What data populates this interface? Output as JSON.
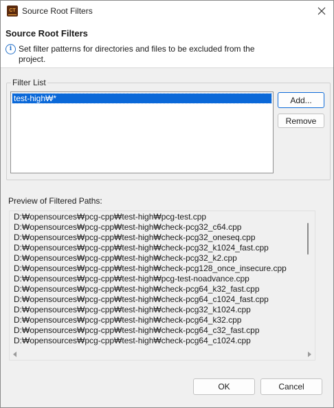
{
  "window": {
    "app_icon_text": "CT",
    "title": "Source Root Filters"
  },
  "header": {
    "title": "Source Root Filters",
    "message": "Set filter patterns for directories and files to be excluded from the project."
  },
  "filter_list": {
    "group_label": "Filter List",
    "items": [
      "test-high₩*"
    ],
    "selected_index": 0
  },
  "buttons": {
    "add": "Add...",
    "remove": "Remove",
    "ok": "OK",
    "cancel": "Cancel"
  },
  "preview": {
    "label": "Preview of Filtered Paths:",
    "paths": [
      "D:₩opensources₩pcg-cpp₩test-high₩pcg-test.cpp",
      "D:₩opensources₩pcg-cpp₩test-high₩check-pcg32_c64.cpp",
      "D:₩opensources₩pcg-cpp₩test-high₩check-pcg32_oneseq.cpp",
      "D:₩opensources₩pcg-cpp₩test-high₩check-pcg32_k1024_fast.cpp",
      "D:₩opensources₩pcg-cpp₩test-high₩check-pcg32_k2.cpp",
      "D:₩opensources₩pcg-cpp₩test-high₩check-pcg128_once_insecure.cpp",
      "D:₩opensources₩pcg-cpp₩test-high₩pcg-test-noadvance.cpp",
      "D:₩opensources₩pcg-cpp₩test-high₩check-pcg64_k32_fast.cpp",
      "D:₩opensources₩pcg-cpp₩test-high₩check-pcg64_c1024_fast.cpp",
      "D:₩opensources₩pcg-cpp₩test-high₩check-pcg32_k1024.cpp",
      "D:₩opensources₩pcg-cpp₩test-high₩check-pcg64_k32.cpp",
      "D:₩opensources₩pcg-cpp₩test-high₩check-pcg64_c32_fast.cpp",
      "D:₩opensources₩pcg-cpp₩test-high₩check-pcg64_c1024.cpp"
    ]
  },
  "colors": {
    "selection": "#0a68d8",
    "info_icon": "#2470c8",
    "dialog_bg": "#f0f0f0"
  }
}
